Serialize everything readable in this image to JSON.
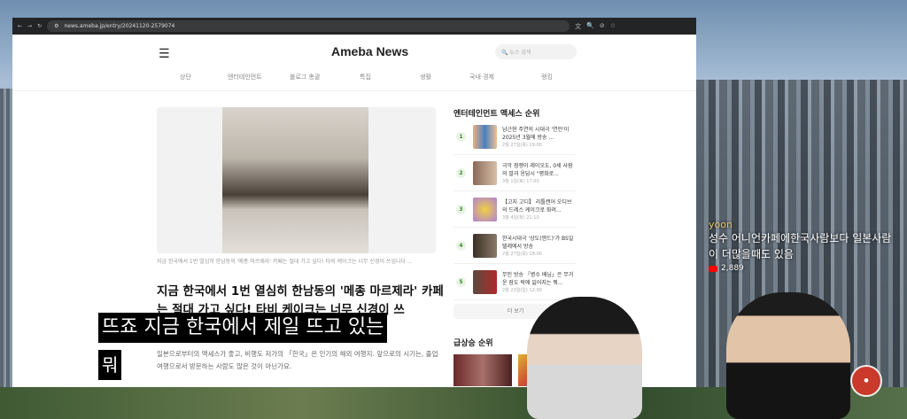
{
  "browser": {
    "url": "news.ameba.jp/entry/20241120-2579074"
  },
  "site": {
    "logo": "Ameba News",
    "search_placeholder": "뉴스 검색",
    "nav": [
      "상단",
      "엔터테인먼트",
      "블로그 총괄",
      "특집",
      "생활",
      "국내·경제",
      "랭킹"
    ]
  },
  "article": {
    "caption": "지금 한국에서 1번 열심히 한남동의 '메종 마르제라' 카페는 절대 가고 싶다! 타비 케이크는 너무 신경이 쓰입니다 ...",
    "title": "지금 한국에서 1번 열심히 한남동의 '메종 마르제라' 카페는 절대 가고 싶다! 타비 케이크는 너무 신경이 쓰",
    "body": "일본으로부터의 액세스가 좋고, 비행도 저가의 「한국」은 인기의 해외 여행지. 앞으로의 시기는, 졸업 여행으로서 방문하는 사람도 많은 것이 아닌가요."
  },
  "sidebar": {
    "heading": "엔터테인먼트 액세스 순위",
    "items": [
      {
        "rank": "1",
        "title": "남근현 주연의 시대극 '연인'이 2025년 3월에 방송 ...",
        "date": "2월 27일(목) 19:00"
      },
      {
        "rank": "2",
        "title": "극악 점쟁이 레이오도, 0세 사람의 말과 응답시 \"평화로...",
        "date": "3월 1일(토) 17:00"
      },
      {
        "rank": "3",
        "title": "【고지 고디】 리틀캔어 오디브의 드레스 케이크로 화려...",
        "date": "3월 4일(화) 21:10"
      },
      {
        "rank": "4",
        "title": "한국시대극 '상도(앤드)'가 BS일텔레에서 방송",
        "date": "2월 27일(목) 18:00"
      },
      {
        "rank": "5",
        "title": "무인 방송 「병수 배님」은 무거운 잠도 락에 잃어지는 뭐...",
        "date": "2월 23일(일) 12:00"
      }
    ],
    "more": "더 보기",
    "heading2": "급상승 순위"
  },
  "subtitles": {
    "line1": "뜨죠 지금 한국에서 제일 뜨고 있는",
    "line2": "뭐"
  },
  "live_chat": {
    "user": "yoon",
    "message": "성수 어니언카페에한국사람보다 일본사람이 더많을때도 있음",
    "amount": "2,889"
  },
  "colors": {
    "chat_name": "#e8c46a",
    "rank_green": "#3a8a2e"
  }
}
